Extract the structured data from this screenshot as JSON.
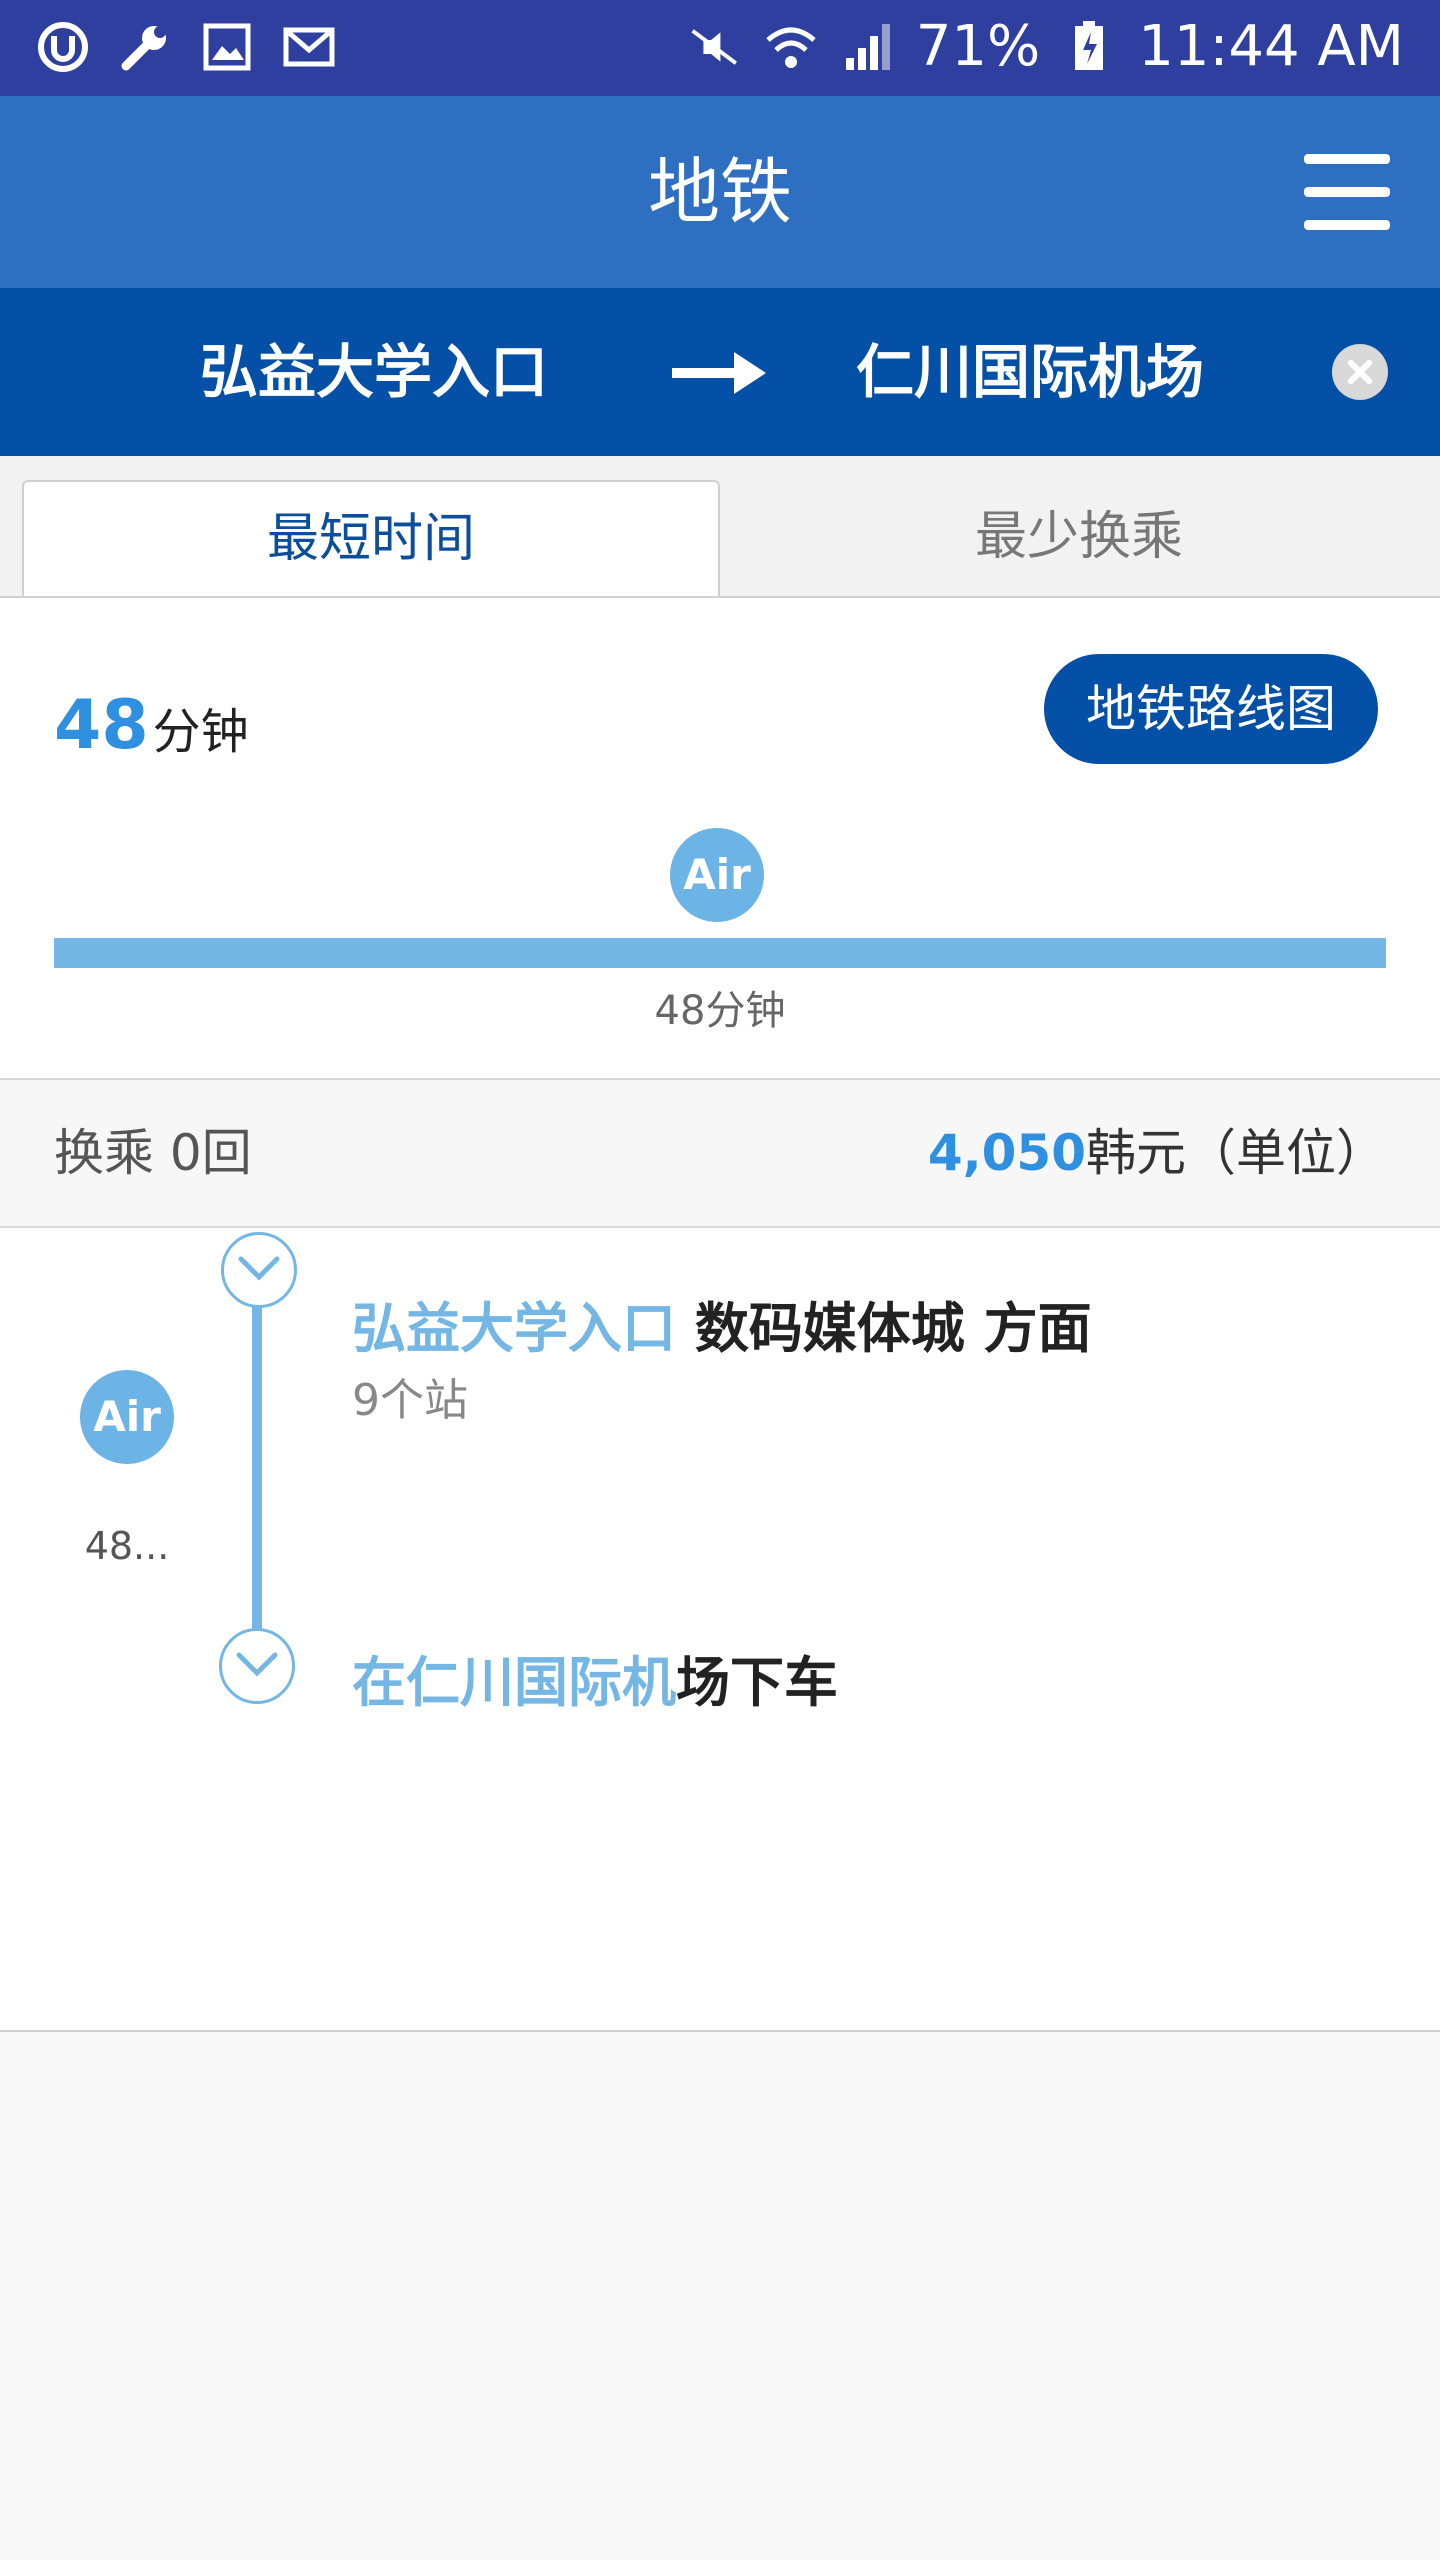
{
  "status_bar": {
    "battery": "71%",
    "time": "11:44 AM",
    "icons": [
      "uplus-icon",
      "wrench-icon",
      "image-icon",
      "mail-icon",
      "mute-icon",
      "wifi-icon",
      "signal-icon",
      "battery-charging-icon"
    ]
  },
  "app_bar": {
    "title": "地铁"
  },
  "route": {
    "from": "弘益大学入口",
    "to": "仁川国际机场"
  },
  "tabs": [
    {
      "label": "最短时间",
      "active": true
    },
    {
      "label": "最少换乘",
      "active": false
    }
  ],
  "summary": {
    "total_minutes": "48",
    "minutes_unit": "分钟",
    "map_button_label": "地铁路线图",
    "line_badge": "Air",
    "segment_label": "48分钟"
  },
  "fare": {
    "transfer_label": "换乘 0回",
    "amount": "4,050",
    "unit": "韩元（单位）"
  },
  "detail": {
    "side_badge": "Air",
    "side_time": "48...",
    "segment_from": "弘益大学入口",
    "segment_direction": "数码媒体城 方面",
    "stops": "9个站",
    "alight_highlight": "在仁川国际机",
    "alight_rest": "场下车"
  },
  "colors": {
    "status_bar": "#2f3f9f",
    "app_bar": "#2e6fc1",
    "route_bar": "#0450a7",
    "accent": "#2f8fe0",
    "line_air": "#74b6e4"
  }
}
